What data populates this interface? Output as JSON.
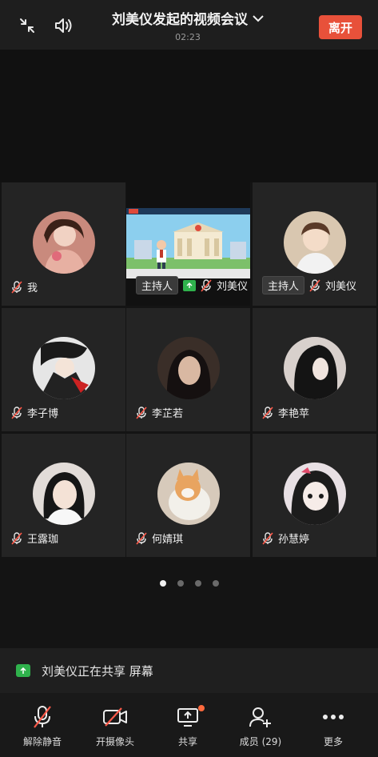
{
  "header": {
    "title": "刘美仪发起的视频会议",
    "timer": "02:23",
    "leave_label": "离开"
  },
  "participants": [
    {
      "name": "我",
      "muted": true
    },
    {
      "name": "刘美仪",
      "host_label": "主持人",
      "sharing": true,
      "muted": true
    },
    {
      "name": "刘美仪",
      "host_label": "主持人",
      "muted": true
    },
    {
      "name": "李子博",
      "muted": true
    },
    {
      "name": "李芷若",
      "muted": true
    },
    {
      "name": "李艳苹",
      "muted": true
    },
    {
      "name": "王露珈",
      "muted": true
    },
    {
      "name": "何婧琪",
      "muted": true
    },
    {
      "name": "孙慧婷",
      "muted": true
    }
  ],
  "pagination": {
    "current": 1,
    "total": 4
  },
  "share_banner": {
    "text": "刘美仪正在共享 屏幕"
  },
  "toolbar": {
    "unmute_label": "解除静音",
    "camera_label": "开摄像头",
    "share_label": "共享",
    "members_label": "成员 (29)",
    "more_label": "更多"
  },
  "colors": {
    "leave": "#e8513a",
    "share_green": "#2fb24c",
    "notify": "#ff6a3d"
  }
}
